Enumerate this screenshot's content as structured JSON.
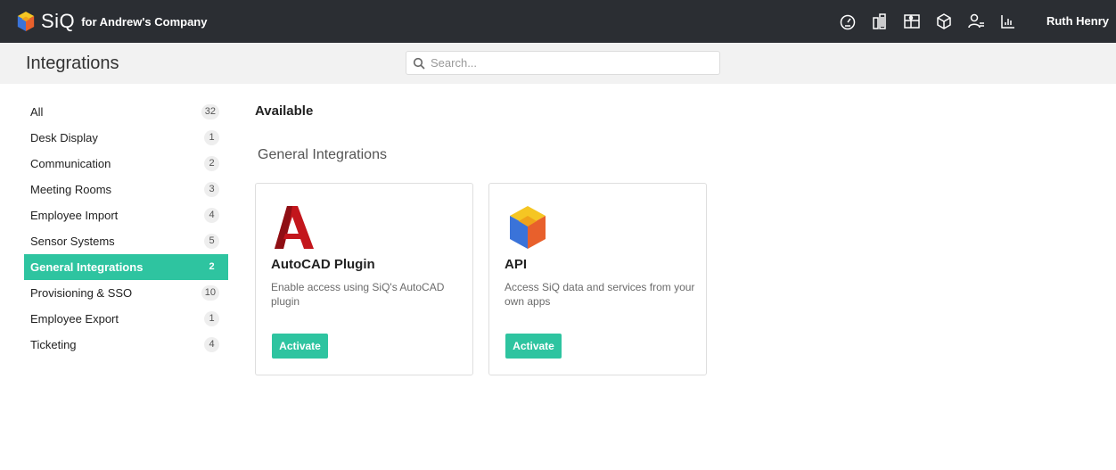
{
  "header": {
    "brand_name": "SiQ",
    "company": "for Andrew's Company",
    "user_name": "Ruth Henry",
    "icons": [
      "dashboard-icon",
      "buildings-icon",
      "floorplan-icon",
      "box-icon",
      "users-icon",
      "analytics-icon"
    ]
  },
  "page": {
    "title": "Integrations",
    "search_placeholder": "Search..."
  },
  "sidebar": {
    "items": [
      {
        "label": "All",
        "count": "32"
      },
      {
        "label": "Desk Display",
        "count": "1"
      },
      {
        "label": "Communication",
        "count": "2"
      },
      {
        "label": "Meeting Rooms",
        "count": "3"
      },
      {
        "label": "Employee Import",
        "count": "4"
      },
      {
        "label": "Sensor Systems",
        "count": "5"
      },
      {
        "label": "General Integrations",
        "count": "2"
      },
      {
        "label": "Provisioning & SSO",
        "count": "10"
      },
      {
        "label": "Employee Export",
        "count": "1"
      },
      {
        "label": "Ticketing",
        "count": "4"
      }
    ],
    "active": "General Integrations"
  },
  "main": {
    "section_title": "Available",
    "group_title": "General Integrations",
    "cards": [
      {
        "title": "AutoCAD Plugin",
        "description": "Enable access using SiQ's AutoCAD plugin",
        "button": "Activate",
        "logo": "autocad-logo"
      },
      {
        "title": "API",
        "description": "Access SiQ data and services from your own apps",
        "button": "Activate",
        "logo": "siq-logo"
      }
    ]
  },
  "colors": {
    "topbar": "#2b2e33",
    "accent": "#2ec4a0",
    "subheader": "#f2f2f2"
  }
}
